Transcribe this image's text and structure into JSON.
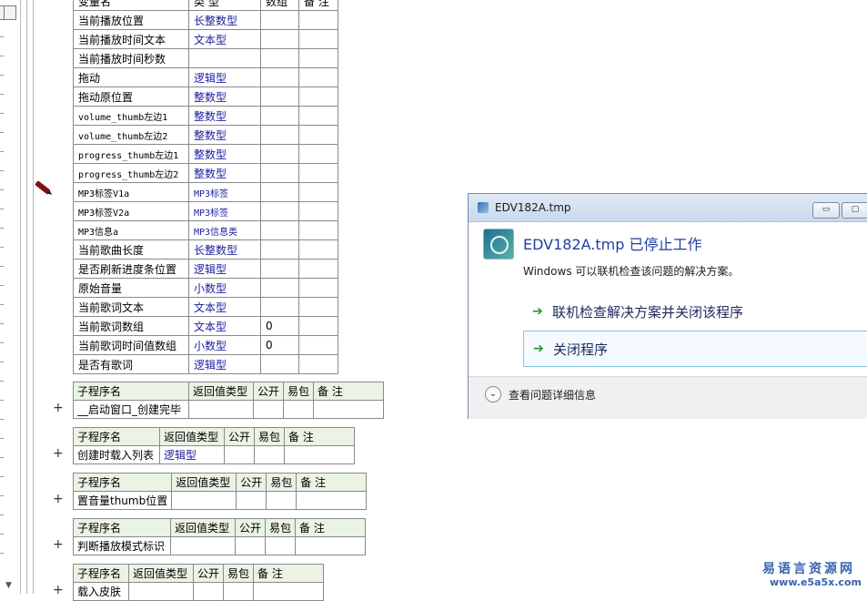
{
  "vars_table": {
    "headers": [
      "变量名",
      "类 型",
      "数组",
      "备 注"
    ],
    "rows": [
      {
        "name": "当前播放位置",
        "type": "长整数型",
        "array": "",
        "note": ""
      },
      {
        "name": "当前播放时间文本",
        "type": "文本型",
        "array": "",
        "note": ""
      },
      {
        "name": "当前播放时间秒数",
        "type": "",
        "array": "",
        "note": ""
      },
      {
        "name": "拖动",
        "type": "逻辑型",
        "array": "",
        "note": ""
      },
      {
        "name": "拖动原位置",
        "type": "整数型",
        "array": "",
        "note": ""
      },
      {
        "name": "volume_thumb左边1",
        "type": "整数型",
        "array": "",
        "note": ""
      },
      {
        "name": "volume_thumb左边2",
        "type": "整数型",
        "array": "",
        "note": ""
      },
      {
        "name": "progress_thumb左边1",
        "type": "整数型",
        "array": "",
        "note": ""
      },
      {
        "name": "progress_thumb左边2",
        "type": "整数型",
        "array": "",
        "note": ""
      },
      {
        "name": "MP3标签V1a",
        "type": "MP3标签",
        "array": "",
        "note": ""
      },
      {
        "name": "MP3标签V2a",
        "type": "MP3标签",
        "array": "",
        "note": ""
      },
      {
        "name": "MP3信息a",
        "type": "MP3信息类",
        "array": "",
        "note": ""
      },
      {
        "name": "当前歌曲长度",
        "type": "长整数型",
        "array": "",
        "note": ""
      },
      {
        "name": "是否刷新进度条位置",
        "type": "逻辑型",
        "array": "",
        "note": ""
      },
      {
        "name": "原始音量",
        "type": "小数型",
        "array": "",
        "note": ""
      },
      {
        "name": "当前歌词文本",
        "type": "文本型",
        "array": "",
        "note": ""
      },
      {
        "name": "当前歌词数组",
        "type": "文本型",
        "array": "0",
        "note": ""
      },
      {
        "name": "当前歌词时间值数组",
        "type": "小数型",
        "array": "0",
        "note": ""
      },
      {
        "name": "是否有歌词",
        "type": "逻辑型",
        "array": "",
        "note": ""
      }
    ]
  },
  "subprograms": {
    "headers": [
      "子程序名",
      "返回值类型",
      "公开",
      "易包",
      "备 注"
    ],
    "expand_symbol": "+",
    "items": [
      {
        "name": "__启动窗口_创建完毕",
        "return_type": ""
      },
      {
        "name": "创建时载入列表",
        "return_type": "逻辑型"
      },
      {
        "name": "置音量thumb位置",
        "return_type": ""
      },
      {
        "name": "判断播放模式标识",
        "return_type": ""
      },
      {
        "name": "载入皮肤",
        "return_type": ""
      }
    ]
  },
  "dialog": {
    "title": "EDV182A.tmp",
    "heading": "EDV182A.tmp 已停止工作",
    "message": "Windows 可以联机检查该问题的解决方案。",
    "option_check_online": "联机检查解决方案并关闭该程序",
    "option_close": "关闭程序",
    "details_label": "查看问题详细信息",
    "minimize_glyph": "▭",
    "maximize_glyph": "▢",
    "arrow_glyph": "➔",
    "chevron_glyph": "⌄"
  },
  "watermark": {
    "line1": "易语言资源网",
    "line2": "www.e5a5x.com"
  }
}
